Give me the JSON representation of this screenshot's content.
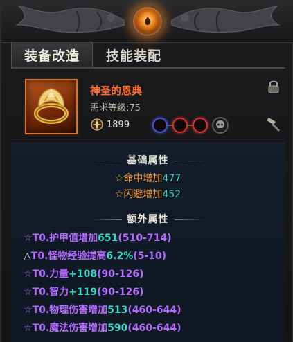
{
  "tabs": [
    {
      "label": "装备改造",
      "active": true
    },
    {
      "label": "技能装配",
      "active": false
    }
  ],
  "item": {
    "name": "神圣的恩典",
    "requirement": "需求等级:75",
    "power": "1899",
    "sockets": [
      "blue",
      "red",
      "red"
    ],
    "icons": [
      "ring-icon",
      "power-icon",
      "skull-icon",
      "lock-icon",
      "hammer-icon"
    ]
  },
  "base_attributes": {
    "title": "基础属性",
    "lines": [
      {
        "star": "☆",
        "label": "命中增加",
        "value": "477"
      },
      {
        "star": "☆",
        "label": "闪避增加",
        "value": "452"
      }
    ]
  },
  "extra_attributes": {
    "title": "额外属性",
    "lines": [
      {
        "prefix": "☆",
        "label": "T0.护甲值增加",
        "value": "651",
        "range": "(510-714)"
      },
      {
        "prefix": "△",
        "label": "T0.怪物经验提高",
        "value": "6.2%",
        "range": "(5-10)"
      },
      {
        "prefix": "☆",
        "label": "T0.力量",
        "value": "+108",
        "range": "(90-126)"
      },
      {
        "prefix": "☆",
        "label": "T0.智力",
        "value": "+119",
        "range": "(90-126)"
      },
      {
        "prefix": "☆",
        "label": "T0.物理伤害增加",
        "value": "513",
        "range": "(460-644)"
      },
      {
        "prefix": "☆",
        "label": "T0.魔法伤害增加",
        "value": "590",
        "range": "(460-644)"
      }
    ]
  },
  "colors": {
    "item_name": "#ff6a2a",
    "accent_orange": "#ff9a2e",
    "value_cyan": "#3ad8c8",
    "extra_purple": "#b46cff",
    "socket_blue": "#3a56d6",
    "socket_red": "#d83030"
  }
}
